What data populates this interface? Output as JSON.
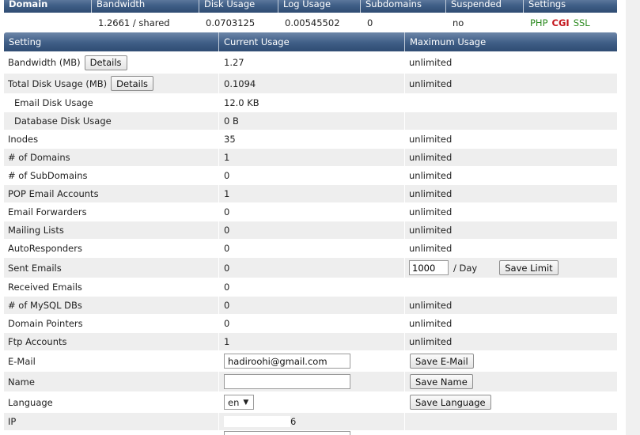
{
  "top_header": [
    "Domain",
    "Bandwidth",
    "Disk Usage",
    "Log Usage",
    "Subdomains",
    "Suspended",
    "Settings"
  ],
  "top_row": {
    "domain": "",
    "bandwidth": "1.2661 / shared",
    "disk_usage": "0.0703125",
    "log_usage": "0.00545502",
    "subdomains": "0",
    "suspended": "no",
    "settings": {
      "php": "PHP",
      "cgi": "CGI",
      "ssl": "SSL"
    }
  },
  "main_header": [
    "Setting",
    "Current Usage",
    "Maximum Usage"
  ],
  "rows": {
    "bandwidth": {
      "label": "Bandwidth (MB)",
      "button": "Details",
      "current": "1.27",
      "max": "unlimited"
    },
    "disk": {
      "label": "Total Disk Usage (MB)",
      "button": "Details",
      "current": "0.1094",
      "max": "unlimited"
    },
    "email_disk": {
      "label": "Email Disk Usage",
      "current": "12.0 KB"
    },
    "db_disk": {
      "label": "Database Disk Usage",
      "current": "0 B"
    },
    "inodes": {
      "label": "Inodes",
      "current": "35",
      "max": "unlimited"
    },
    "domains": {
      "label": "# of Domains",
      "current": "1",
      "max": "unlimited"
    },
    "subdomains": {
      "label": "# of SubDomains",
      "current": "0",
      "max": "unlimited"
    },
    "pop": {
      "label": "POP Email Accounts",
      "current": "1",
      "max": "unlimited"
    },
    "forwarders": {
      "label": "Email Forwarders",
      "current": "0",
      "max": "unlimited"
    },
    "mailing": {
      "label": "Mailing Lists",
      "current": "0",
      "max": "unlimited"
    },
    "autoresponders": {
      "label": "AutoResponders",
      "current": "0",
      "max": "unlimited"
    },
    "sent": {
      "label": "Sent Emails",
      "current": "0",
      "limit_value": "1000",
      "per": "/ Day",
      "button": "Save Limit"
    },
    "received": {
      "label": "Received Emails",
      "current": "0"
    },
    "mysql": {
      "label": "# of MySQL DBs",
      "current": "0",
      "max": "unlimited"
    },
    "pointers": {
      "label": "Domain Pointers",
      "current": "0",
      "max": "unlimited"
    },
    "ftp": {
      "label": "Ftp Accounts",
      "current": "1",
      "max": "unlimited"
    },
    "email": {
      "label": "E-Mail",
      "value": "hadiroohi@gmail.com",
      "button": "Save E-Mail"
    },
    "name": {
      "label": "Name",
      "value": "",
      "button": "Save Name"
    },
    "language": {
      "label": "Language",
      "value": "en",
      "button": "Save Language"
    },
    "ip": {
      "label": "IP",
      "value_suffix": "6"
    }
  }
}
